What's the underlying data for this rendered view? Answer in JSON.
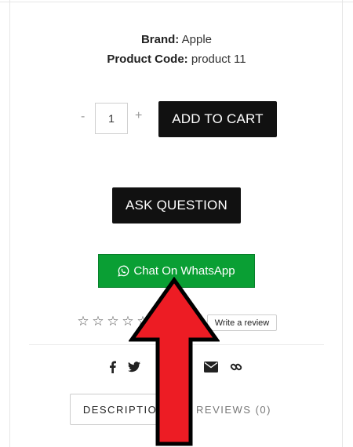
{
  "product": {
    "brand_label": "Brand:",
    "brand_value": "Apple",
    "code_label": "Product Code:",
    "code_value": "product 11"
  },
  "quantity": {
    "minus_label": "-",
    "value": "1",
    "plus_label": "+"
  },
  "buttons": {
    "add_to_cart": "ADD TO CART",
    "ask_question": "ASK QUESTION",
    "whatsapp": "Chat On WhatsApp"
  },
  "rating": {
    "stars_filled": 0,
    "stars_total": 5,
    "star_glyph": "☆",
    "write_review": "Write a review"
  },
  "share": {
    "icons": [
      "facebook-icon",
      "twitter-icon",
      "envelope-icon",
      "link-icon"
    ]
  },
  "tabs": {
    "description": "DESCRIPTION",
    "reviews": "REVIEWS (0)"
  },
  "colors": {
    "button_dark": "#111111",
    "whatsapp_green": "#0a9f34",
    "arrow_red": "#ed1c24"
  }
}
